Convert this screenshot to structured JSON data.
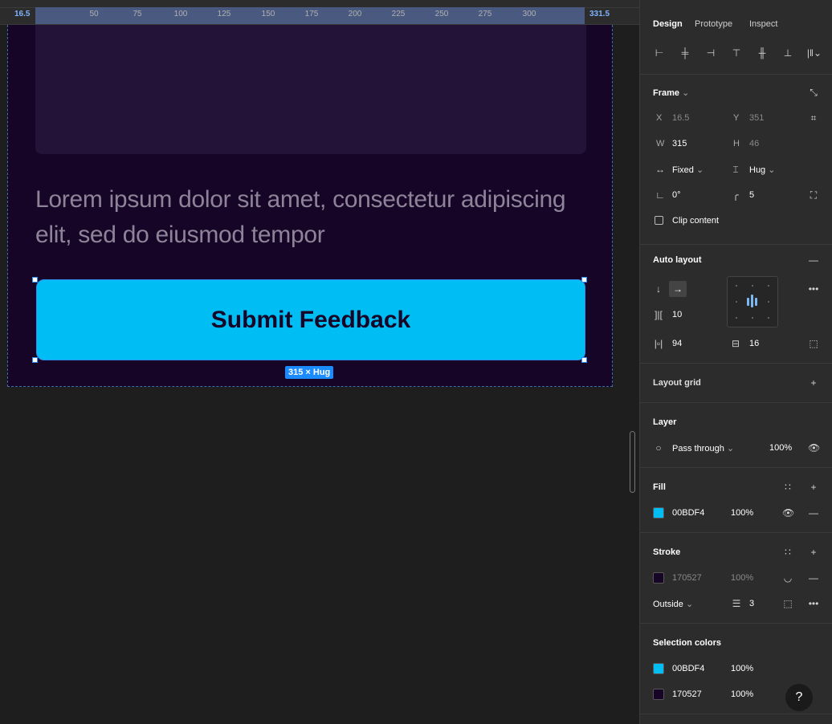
{
  "ruler": {
    "left_edge": "16.5",
    "right_edge": "331.5",
    "ticks": [
      "50",
      "75",
      "100",
      "125",
      "150",
      "175",
      "200",
      "225",
      "250",
      "275",
      "300"
    ]
  },
  "canvas": {
    "paragraph": "Lorem ipsum dolor sit amet, consectetur adipiscing elit, sed do eiusmod tempor",
    "button_label": "Submit Feedback",
    "size_badge": "315 × Hug"
  },
  "panel": {
    "tabs": [
      "Design",
      "Prototype",
      "Inspect"
    ],
    "frame": {
      "title": "Frame",
      "x_label": "X",
      "x": "16.5",
      "y_label": "Y",
      "y": "351",
      "w_label": "W",
      "w": "315",
      "h_label": "H",
      "h": "46",
      "width_mode": "Fixed",
      "height_mode": "Hug",
      "rotation": "0°",
      "radius": "5",
      "clip_content": "Clip content"
    },
    "auto_layout": {
      "title": "Auto layout",
      "gap": "10",
      "h_padding": "94",
      "v_padding": "16"
    },
    "layout_grid": {
      "title": "Layout grid"
    },
    "layer": {
      "title": "Layer",
      "blend": "Pass through",
      "opacity": "100%"
    },
    "fill": {
      "title": "Fill",
      "hex": "00BDF4",
      "opacity": "100%",
      "color": "#00bdf4"
    },
    "stroke": {
      "title": "Stroke",
      "hex": "170527",
      "opacity": "100%",
      "color": "#170527",
      "position": "Outside",
      "weight": "3"
    },
    "selection_colors": {
      "title": "Selection colors",
      "items": [
        {
          "hex": "00BDF4",
          "opacity": "100%",
          "color": "#00bdf4"
        },
        {
          "hex": "170527",
          "opacity": "100%",
          "color": "#170527"
        }
      ]
    },
    "help": "?"
  }
}
